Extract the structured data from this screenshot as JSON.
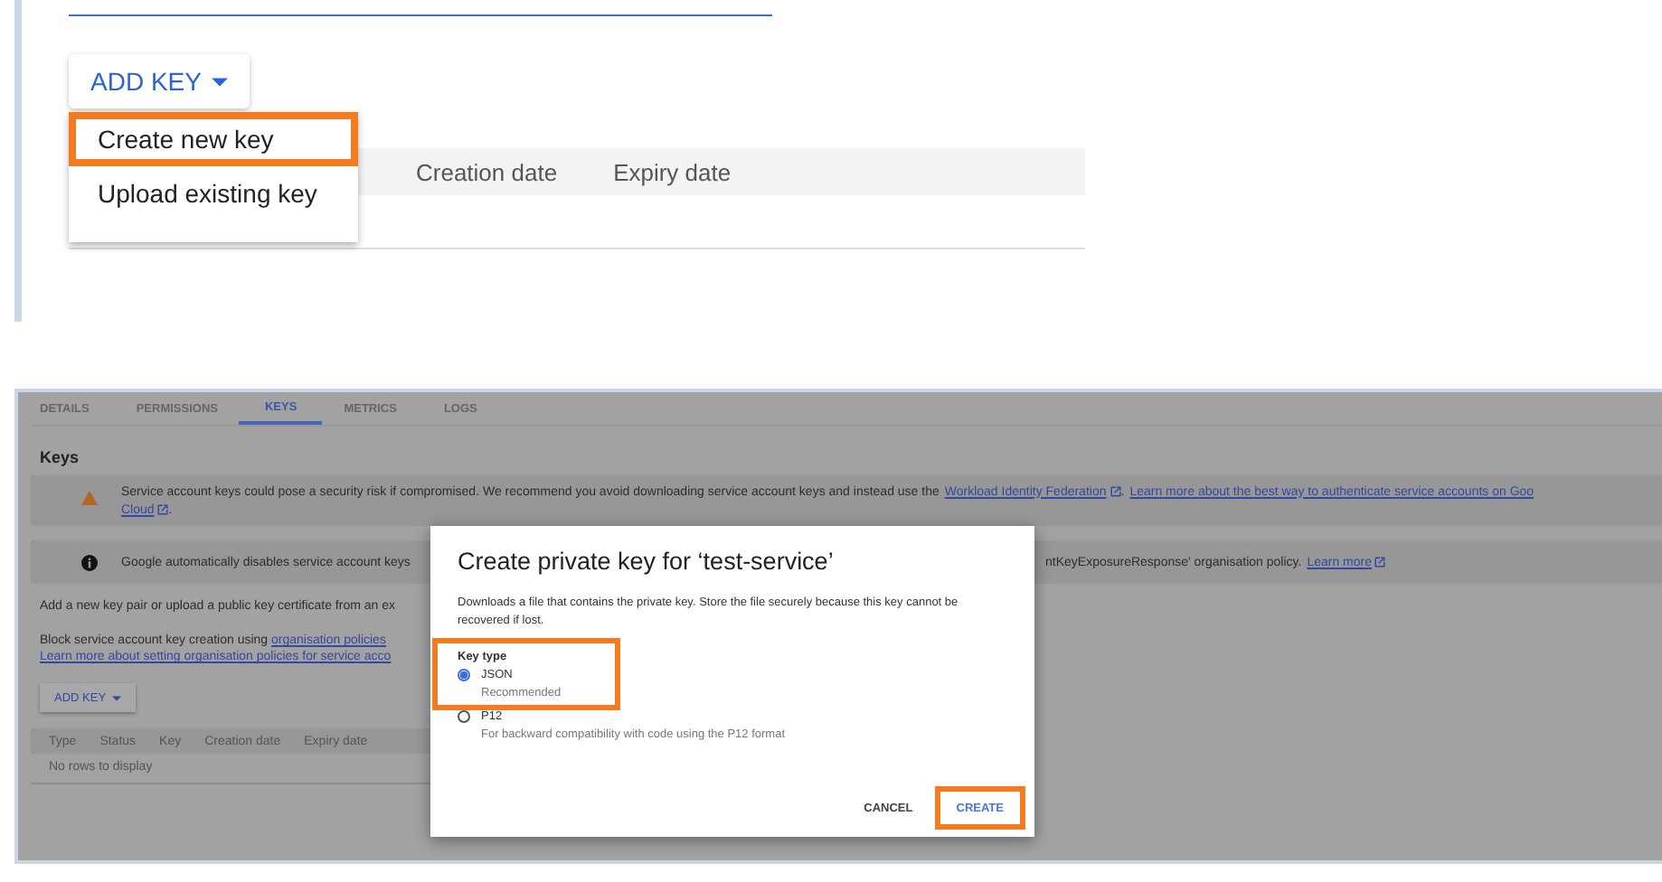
{
  "top_panel": {
    "add_key_button": "ADD KEY",
    "menu": [
      {
        "label": "Create new key",
        "highlighted": true
      },
      {
        "label": "Upload existing key",
        "highlighted": false
      }
    ],
    "table": {
      "columns": [
        "Creation date",
        "Expiry date"
      ]
    }
  },
  "bottom_panel": {
    "tabs": [
      {
        "label": "DETAILS",
        "selected": false
      },
      {
        "label": "PERMISSIONS",
        "selected": false
      },
      {
        "label": "KEYS",
        "selected": true
      },
      {
        "label": "METRICS",
        "selected": false
      },
      {
        "label": "LOGS",
        "selected": false
      }
    ],
    "heading": "Keys",
    "warning": {
      "text": "Service account keys could pose a security risk if compromised. We recommend you avoid downloading service account keys and instead use the ",
      "link_1": "Workload Identity Federation",
      "link_2": "Learn more about the best way to authenticate service accounts on Goo",
      "link_3": "Cloud",
      "punctuation_1": ".",
      "punctuation_2": "."
    },
    "info": {
      "text_left": "Google automatically disables service account keys",
      "text_right": "ntKeyExposureResponse' organisation policy.",
      "link": "Learn more"
    },
    "intro": "Add a new key pair or upload a public key certificate from an ex",
    "block_text": "Block service account key creation using ",
    "block_link": "organisation policies",
    "policy_link": "Learn more about setting organisation policies for service acco",
    "add_key_button": "ADD KEY",
    "table": {
      "columns": [
        "Type",
        "Status",
        "Key",
        "Creation date",
        "Expiry date"
      ],
      "empty": "No rows to display"
    }
  },
  "dialog": {
    "title": "Create private key for ‘test-service’",
    "description": "Downloads a file that contains the private key. Store the file securely because this key cannot be recovered if lost.",
    "key_type_label": "Key type",
    "options": [
      {
        "label": "JSON",
        "hint": "Recommended",
        "selected": true,
        "highlighted": true
      },
      {
        "label": "P12",
        "hint": "For backward compatibility with code using the P12 format",
        "selected": false,
        "highlighted": false
      }
    ],
    "buttons": [
      {
        "label": "CANCEL",
        "kind": "text",
        "highlighted": false
      },
      {
        "label": "CREATE",
        "kind": "primary",
        "highlighted": true
      }
    ]
  }
}
